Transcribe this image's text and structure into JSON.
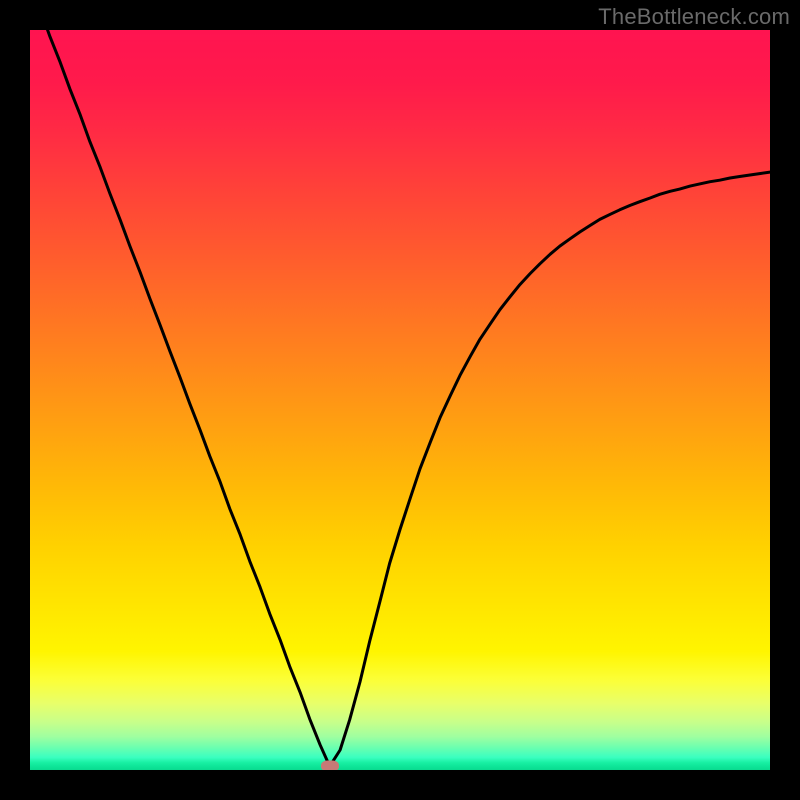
{
  "watermark": "TheBottleneck.com",
  "chart_data": {
    "type": "line",
    "title": "",
    "xlabel": "",
    "ylabel": "",
    "xlim": [
      0,
      100
    ],
    "ylim": [
      0,
      100
    ],
    "grid": false,
    "legend": false,
    "gradient_stops": [
      {
        "pct": 0,
        "color": "#ff1450"
      },
      {
        "pct": 7,
        "color": "#ff1a4b"
      },
      {
        "pct": 14,
        "color": "#ff2b44"
      },
      {
        "pct": 22,
        "color": "#ff4338"
      },
      {
        "pct": 30,
        "color": "#ff5a2e"
      },
      {
        "pct": 38,
        "color": "#ff7224"
      },
      {
        "pct": 46,
        "color": "#ff8a1a"
      },
      {
        "pct": 54,
        "color": "#ffa210"
      },
      {
        "pct": 62,
        "color": "#ffba06"
      },
      {
        "pct": 70,
        "color": "#ffd200"
      },
      {
        "pct": 78,
        "color": "#ffe600"
      },
      {
        "pct": 84,
        "color": "#fff500"
      },
      {
        "pct": 88,
        "color": "#fbff3a"
      },
      {
        "pct": 91,
        "color": "#e8ff6a"
      },
      {
        "pct": 93.5,
        "color": "#c8ff8a"
      },
      {
        "pct": 95.5,
        "color": "#9fffa0"
      },
      {
        "pct": 97,
        "color": "#6affb0"
      },
      {
        "pct": 98.3,
        "color": "#3affc0"
      },
      {
        "pct": 99,
        "color": "#18f0a3"
      },
      {
        "pct": 99.5,
        "color": "#0ee598"
      },
      {
        "pct": 100,
        "color": "#09db8f"
      }
    ],
    "series": [
      {
        "name": "bottleneck-curve",
        "x": [
          0.0,
          1.4,
          2.7,
          4.1,
          5.4,
          6.8,
          8.1,
          9.5,
          10.8,
          12.2,
          13.5,
          14.9,
          16.2,
          17.6,
          18.9,
          20.3,
          21.6,
          23.0,
          24.3,
          25.7,
          27.0,
          28.4,
          29.7,
          31.1,
          32.4,
          33.8,
          35.1,
          36.5,
          37.8,
          39.2,
          40.5,
          41.9,
          43.2,
          44.6,
          45.9,
          47.3,
          48.6,
          50.0,
          51.4,
          52.7,
          54.1,
          55.4,
          56.8,
          58.1,
          59.5,
          60.8,
          62.2,
          63.5,
          64.9,
          66.2,
          67.6,
          68.9,
          70.3,
          71.6,
          73.0,
          74.3,
          75.7,
          77.0,
          78.4,
          79.7,
          81.1,
          82.4,
          83.8,
          85.1,
          86.5,
          87.8,
          89.2,
          90.5,
          91.9,
          93.2,
          94.6,
          95.9,
          97.3,
          98.6,
          100.0
        ],
        "y": [
          106.2,
          102.7,
          99.1,
          95.6,
          92.0,
          88.5,
          84.9,
          81.4,
          77.9,
          74.3,
          70.8,
          67.2,
          63.7,
          60.1,
          56.6,
          53.0,
          49.5,
          45.9,
          42.4,
          38.9,
          35.3,
          31.8,
          28.2,
          24.7,
          21.1,
          17.6,
          14.0,
          10.5,
          6.9,
          3.4,
          0.5,
          2.7,
          6.8,
          11.9,
          17.4,
          22.8,
          27.9,
          32.5,
          36.8,
          40.7,
          44.3,
          47.6,
          50.6,
          53.3,
          55.9,
          58.2,
          60.3,
          62.2,
          64.0,
          65.6,
          67.1,
          68.4,
          69.7,
          70.8,
          71.8,
          72.7,
          73.6,
          74.4,
          75.1,
          75.7,
          76.3,
          76.8,
          77.3,
          77.8,
          78.2,
          78.5,
          78.9,
          79.2,
          79.5,
          79.7,
          80.0,
          80.2,
          80.4,
          80.6,
          80.8
        ]
      }
    ],
    "marker": {
      "x": 40.5,
      "y": 0.5,
      "color": "#c67a76"
    }
  }
}
